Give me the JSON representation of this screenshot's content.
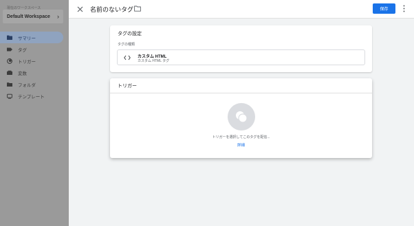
{
  "sidebar": {
    "workspace_label": "現在のワークスペース",
    "workspace_name": "Default Workspace",
    "items": [
      {
        "label": "サマリー",
        "icon": "summary-icon",
        "active": true
      },
      {
        "label": "タグ",
        "icon": "tag-icon"
      },
      {
        "label": "トリガー",
        "icon": "trigger-icon"
      },
      {
        "label": "変数",
        "icon": "variables-icon"
      },
      {
        "label": "フォルダ",
        "icon": "folder-icon"
      },
      {
        "label": "テンプレート",
        "icon": "template-icon"
      }
    ]
  },
  "header": {
    "title": "名前のないタグ",
    "save_label": "保存"
  },
  "tag_config": {
    "title": "タグの設定",
    "type_label": "タグの種類",
    "type_name": "カスタム HTML",
    "type_desc": "カスタム HTML タグ"
  },
  "triggering": {
    "title": "トリガー",
    "hint": "トリガーを選択してこのタグを配信...",
    "details_link": "詳細"
  },
  "colors": {
    "accent": "#1a73e8",
    "overlay_sidebar": "#9a9a9a"
  }
}
